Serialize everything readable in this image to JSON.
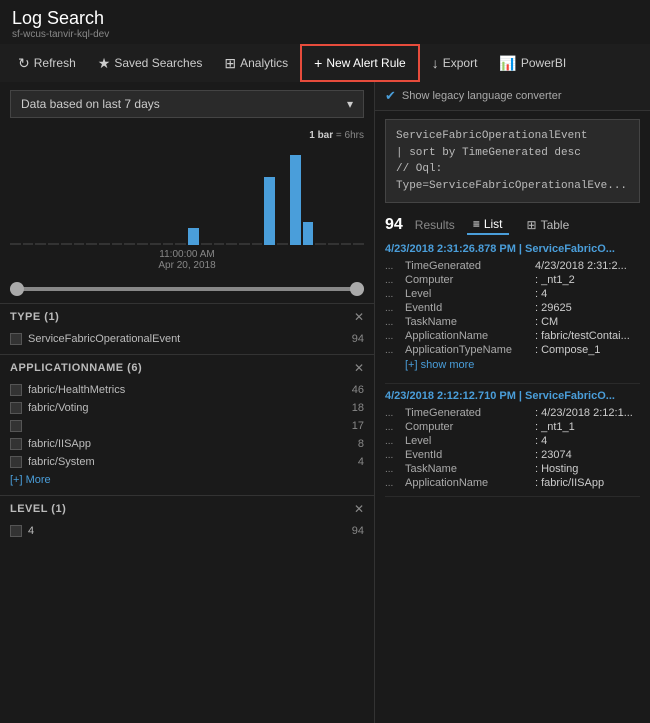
{
  "header": {
    "title": "Log Search",
    "subtitle": "sf-wcus-tanvir-kql-dev"
  },
  "toolbar": {
    "refresh_label": "Refresh",
    "saved_searches_label": "Saved Searches",
    "analytics_label": "Analytics",
    "new_alert_label": "New Alert Rule",
    "export_label": "Export",
    "powerbi_label": "PowerBI"
  },
  "date_filter": {
    "label": "Data based on last 7 days"
  },
  "chart": {
    "legend": "1 bar = 6hrs",
    "xaxis_line1": "11:00:00 AM",
    "xaxis_line2": "Apr 20, 2018",
    "bars": [
      0,
      0,
      0,
      0,
      0,
      0,
      0,
      0,
      0,
      0,
      0,
      0,
      0,
      0,
      15,
      0,
      0,
      0,
      0,
      0,
      60,
      0,
      80,
      20,
      0,
      0,
      0,
      0
    ]
  },
  "filters": {
    "type_section": {
      "title": "TYPE  (1)",
      "items": [
        {
          "label": "ServiceFabricOperationalEvent",
          "count": 94
        }
      ]
    },
    "appname_section": {
      "title": "APPLICATIONNAME  (6)",
      "items": [
        {
          "label": "fabric/HealthMetrics",
          "count": 46
        },
        {
          "label": "fabric/Voting",
          "count": 18
        },
        {
          "label": "",
          "count": 17
        },
        {
          "label": "fabric/IISApp",
          "count": 8
        },
        {
          "label": "fabric/System",
          "count": 4
        }
      ],
      "more_label": "[+] More"
    },
    "level_section": {
      "title": "LEVEL  (1)",
      "items": [
        {
          "label": "4",
          "count": 94
        }
      ]
    }
  },
  "right_panel": {
    "legacy_label": "Show legacy language converter",
    "query_lines": [
      "ServiceFabricOperationalEvent",
      "| sort by TimeGenerated desc",
      "// Oql: Type=ServiceFabricOperationalEve..."
    ],
    "results_count": "94",
    "results_label": "Results",
    "view_list_label": "List",
    "view_table_label": "Table",
    "log_entries": [
      {
        "header": "4/23/2018 2:31:26.878 PM | ServiceFabricO...",
        "fields": [
          {
            "key": "TimeGenerated",
            "val": "4/23/2018 2:31:2..."
          },
          {
            "key": "Computer",
            "val": ": _nt1_2"
          },
          {
            "key": "Level",
            "val": ": 4"
          },
          {
            "key": "EventId",
            "val": ": 29625"
          },
          {
            "key": "TaskName",
            "val": ": CM"
          },
          {
            "key": "ApplicationName",
            "val": ": fabric/testContai..."
          },
          {
            "key": "ApplicationTypeName",
            "val": ": Compose_1"
          }
        ],
        "show_more": "[+] show more"
      },
      {
        "header": "4/23/2018 2:12:12.710 PM | ServiceFabricO...",
        "fields": [
          {
            "key": "TimeGenerated",
            "val": ": 4/23/2018 2:12:1..."
          },
          {
            "key": "Computer",
            "val": ": _nt1_1"
          },
          {
            "key": "Level",
            "val": ": 4"
          },
          {
            "key": "EventId",
            "val": ": 23074"
          },
          {
            "key": "TaskName",
            "val": ": Hosting"
          },
          {
            "key": "ApplicationName",
            "val": ": fabric/IISApp"
          }
        ]
      }
    ]
  }
}
